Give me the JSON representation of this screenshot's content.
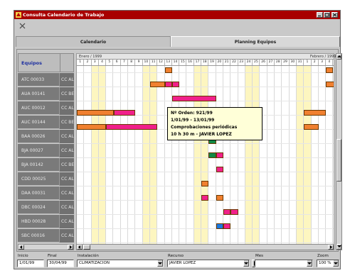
{
  "window": {
    "title": "Consulta Calendario de Trabajo",
    "titlebar_color": "#a80000"
  },
  "tabs": [
    {
      "label": "Calendario",
      "active": false
    },
    {
      "label": "Planning Equipos",
      "active": true
    }
  ],
  "equipment": {
    "header": "Equipos",
    "rows": [
      {
        "code": "ATC 00033",
        "cc": "CC AL"
      },
      {
        "code": "AUA 00141",
        "cc": "CC BE"
      },
      {
        "code": "AUC 00012",
        "cc": "CC AL"
      },
      {
        "code": "AUC 00144",
        "cc": "CC BE"
      },
      {
        "code": "BAA 00026",
        "cc": "CC AL"
      },
      {
        "code": "BJA 00027",
        "cc": "CC AL"
      },
      {
        "code": "BJA 00142",
        "cc": "CC BE"
      },
      {
        "code": "CDD 00025",
        "cc": "CC AL"
      },
      {
        "code": "DAA 00031",
        "cc": "CC AL"
      },
      {
        "code": "DBC 00024",
        "cc": "CC AL"
      },
      {
        "code": "HBD 00028",
        "cc": "CC AL"
      },
      {
        "code": "SBC 00016",
        "cc": "CC AL"
      }
    ]
  },
  "calendar": {
    "month_left": "Enero / 1999",
    "month_right": "Febrero / 1999",
    "days": [
      "1",
      "2",
      "3",
      "4",
      "5",
      "6",
      "7",
      "8",
      "9",
      "10",
      "11",
      "12",
      "13",
      "14",
      "15",
      "16",
      "17",
      "18",
      "19",
      "20",
      "21",
      "22",
      "23",
      "24",
      "25",
      "26",
      "27",
      "28",
      "29",
      "30",
      "31",
      "1",
      "2",
      "3",
      "4"
    ],
    "weekend_days": [
      2,
      3,
      9,
      10,
      16,
      17,
      23,
      24,
      30,
      31
    ],
    "weekend_color": "#fdf6c0",
    "bars": [
      {
        "row": 0,
        "start": 12.0,
        "end": 13.0,
        "color": "#f08030"
      },
      {
        "row": 0,
        "start": 34.0,
        "end": 35.0,
        "color": "#f08030"
      },
      {
        "row": 1,
        "start": 13.0,
        "end": 14.0,
        "color": "#f0208a"
      },
      {
        "row": 1,
        "start": 10.0,
        "end": 12.0,
        "color": "#f08030"
      },
      {
        "row": 1,
        "start": 12.0,
        "end": 13.0,
        "color": "#f0208a"
      },
      {
        "row": 1,
        "start": 34.0,
        "end": 36.0,
        "color": "#f08030"
      },
      {
        "row": 2,
        "start": 13.0,
        "end": 19.0,
        "color": "#f0208a"
      },
      {
        "row": 2,
        "start": 35.0,
        "end": 36.0,
        "color": "#f08030"
      },
      {
        "row": 3,
        "start": 0.0,
        "end": 5.0,
        "color": "#f08030"
      },
      {
        "row": 3,
        "start": 31.0,
        "end": 34.0,
        "color": "#f08030"
      },
      {
        "row": 3,
        "start": 5.0,
        "end": 8.0,
        "color": "#f0208a"
      },
      {
        "row": 4,
        "start": 0.0,
        "end": 4.0,
        "color": "#f08030"
      },
      {
        "row": 4,
        "start": 4.0,
        "end": 11.0,
        "color": "#f0208a"
      },
      {
        "row": 4,
        "start": 31.0,
        "end": 33.0,
        "color": "#f08030"
      },
      {
        "row": 5,
        "start": 18.0,
        "end": 19.0,
        "color": "#118844"
      },
      {
        "row": 6,
        "start": 18.0,
        "end": 19.0,
        "color": "#118844"
      },
      {
        "row": 6,
        "start": 19.0,
        "end": 20.0,
        "color": "#f0208a"
      },
      {
        "row": 7,
        "start": 19.0,
        "end": 20.0,
        "color": "#f0208a"
      },
      {
        "row": 7,
        "start": 35.0,
        "end": 36.0,
        "color": "#f08030"
      },
      {
        "row": 8,
        "start": 17.0,
        "end": 18.0,
        "color": "#f08030"
      },
      {
        "row": 8,
        "start": 35.0,
        "end": 36.0,
        "color": "#f08030"
      },
      {
        "row": 9,
        "start": 17.0,
        "end": 18.0,
        "color": "#f0208a"
      },
      {
        "row": 9,
        "start": 19.0,
        "end": 20.0,
        "color": "#f08030"
      },
      {
        "row": 9,
        "start": 35.0,
        "end": 36.0,
        "color": "#f08030"
      },
      {
        "row": 10,
        "start": 20.0,
        "end": 21.0,
        "color": "#f0208a"
      },
      {
        "row": 10,
        "start": 21.0,
        "end": 22.0,
        "color": "#f0208a"
      },
      {
        "row": 11,
        "start": 19.0,
        "end": 20.0,
        "color": "#1a78e0"
      },
      {
        "row": 11,
        "start": 20.0,
        "end": 21.0,
        "color": "#f0208a"
      }
    ]
  },
  "tooltip": {
    "line1": "Nº Orden: 921/99",
    "line2": "1/01/99 - 13/01/99",
    "line3": "Comprobaciones periódicas",
    "line4": "10 h 30 m - JAVIER LOPEZ"
  },
  "filters": {
    "inicio_label": "Inicio",
    "inicio_value": "1/01/99",
    "final_label": "Final",
    "final_value": "30/04/99",
    "instalacion_label": "Instalación",
    "instalacion_value": "CLIMATIZACION",
    "recurso_label": "Recurso",
    "recurso_value": "JAVIER LOPEZ",
    "mes_label": "Mes",
    "mes_value": "",
    "zoom_label": "Zoom",
    "zoom_value": "100 %"
  },
  "icons": {
    "app": "app-icon",
    "close": "close-x-icon",
    "minimize": "minimize-icon",
    "maximize": "maximize-icon",
    "window_close": "window-close-icon",
    "dropdown": "chevron-down-icon",
    "print": "print-icon"
  }
}
